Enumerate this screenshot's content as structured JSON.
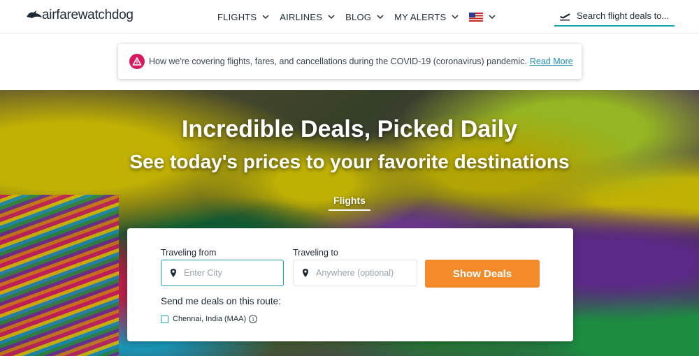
{
  "header": {
    "logo_text": "airfarewatchdog",
    "nav": [
      {
        "label": "FLIGHTS"
      },
      {
        "label": "AIRLINES"
      },
      {
        "label": "BLOG"
      },
      {
        "label": "MY ALERTS"
      }
    ],
    "search_placeholder": "Search flight deals to..."
  },
  "notice": {
    "text": "How we're covering flights, fares, and cancellations during the COVID-19 (coronavirus) pandemic.",
    "link": "Read More"
  },
  "hero": {
    "title": "Incredible Deals, Picked Daily",
    "subtitle": "See today's prices to your favorite destinations",
    "tab": "Flights"
  },
  "search_form": {
    "from_label": "Traveling from",
    "from_placeholder": "Enter City",
    "to_label": "Traveling to",
    "to_placeholder": "Anywhere (optional)",
    "button": "Show Deals",
    "send_label": "Send me deals on this route:",
    "route_option": "Chennai, India (MAA)"
  },
  "colors": {
    "accent": "#1aa3b0",
    "button": "#f48b2b",
    "alert": "#d81b60"
  }
}
